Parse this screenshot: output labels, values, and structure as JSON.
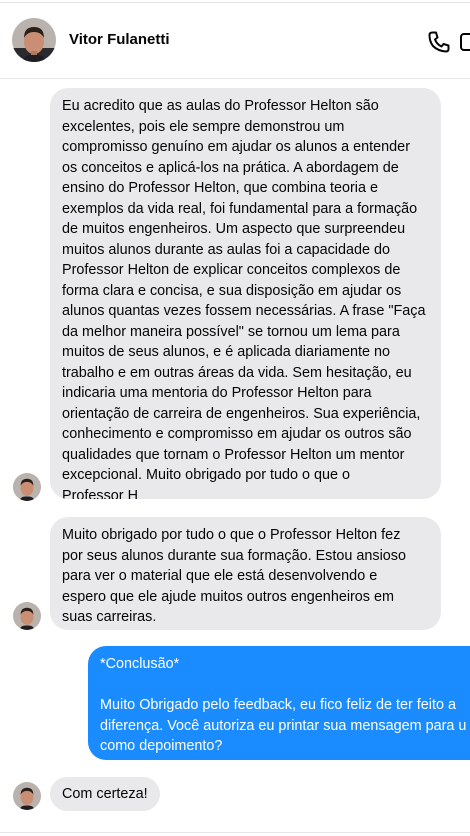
{
  "contact": {
    "name": "Vitor Fulanetti"
  },
  "header": {
    "call_icon": "phone-icon",
    "video_icon": "video-icon"
  },
  "colors": {
    "incoming_bubble": "#e9e9eb",
    "outgoing_bubble": "#1a8cff",
    "text": "#050505"
  },
  "messages": [
    {
      "direction": "incoming",
      "lines": [
        "Eu acredito que as aulas do Professor Helton são",
        "excelentes, pois ele sempre demonstrou um",
        "compromisso genuíno em ajudar os alunos a entender",
        "os conceitos e aplicá-los na prática. A abordagem de",
        "ensino do Professor Helton, que combina teoria e",
        "exemplos da vida real, foi fundamental para a formação",
        "de muitos engenheiros. Um aspecto que surpreendeu",
        "muitos alunos durante as aulas foi a capacidade do",
        "Professor Helton de explicar conceitos complexos de",
        "forma clara e concisa, e sua disposição em ajudar os",
        "alunos quantas vezes fossem necessárias. A frase \"Faça",
        "da melhor maneira possível\" se tornou um lema para",
        "muitos de seus alunos, e é aplicada diariamente no",
        "trabalho e em outras áreas da vida. Sem hesitação, eu",
        "indicaria uma mentoria do Professor Helton para",
        "orientação de carreira de engenheiros. Sua experiência,",
        "conhecimento e compromisso em ajudar os outros são",
        "qualidades que tornam o Professor Helton um mentor",
        "excepcional. Muito obrigado por tudo o que o",
        "Professor H"
      ]
    },
    {
      "direction": "incoming",
      "lines": [
        "Muito obrigado por tudo o que o Professor Helton fez",
        "por seus alunos durante sua formação. Estou ansioso",
        "para ver o material que ele está desenvolvendo e",
        "espero que ele ajude muitos outros engenheiros em",
        "suas carreiras."
      ]
    },
    {
      "direction": "outgoing",
      "title": "*Conclusão*",
      "lines": [
        "Muito Obrigado pelo feedback, eu fico feliz de ter feito a",
        "diferença. Você autoriza eu printar sua mensagem para u",
        "como depoimento?"
      ]
    },
    {
      "direction": "incoming",
      "lines": [
        "Com certeza!"
      ]
    }
  ]
}
